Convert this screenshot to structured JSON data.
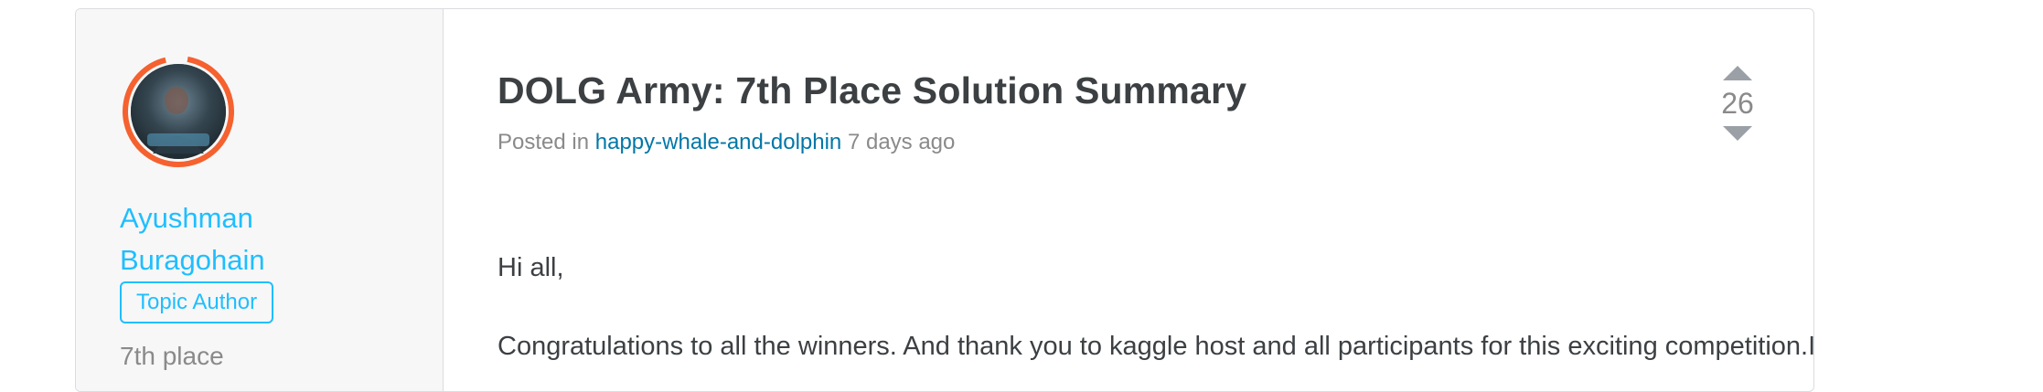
{
  "author": {
    "name": "Ayushman Buragohain",
    "badge": "Topic Author",
    "rank": "7th place"
  },
  "topic": {
    "title": "DOLG Army: 7th Place Solution Summary",
    "posted_prefix": "Posted in",
    "competition": "happy-whale-and-dolphin",
    "age": "7 days ago"
  },
  "vote": {
    "count": "26",
    "up_icon": "triangle-up-icon",
    "down_icon": "triangle-down-icon"
  },
  "body": {
    "greeting": "Hi all,",
    "paragraph_1": "Congratulations to all the winners. And thank you to kaggle host and all participants for this exciting competition.It was as always very tough last week with huge LB changing everybody - fortunately for us"
  },
  "colors": {
    "accent_blue": "#20beff",
    "link_blue": "#0077a8",
    "avatar_ring": "#f5612f"
  }
}
